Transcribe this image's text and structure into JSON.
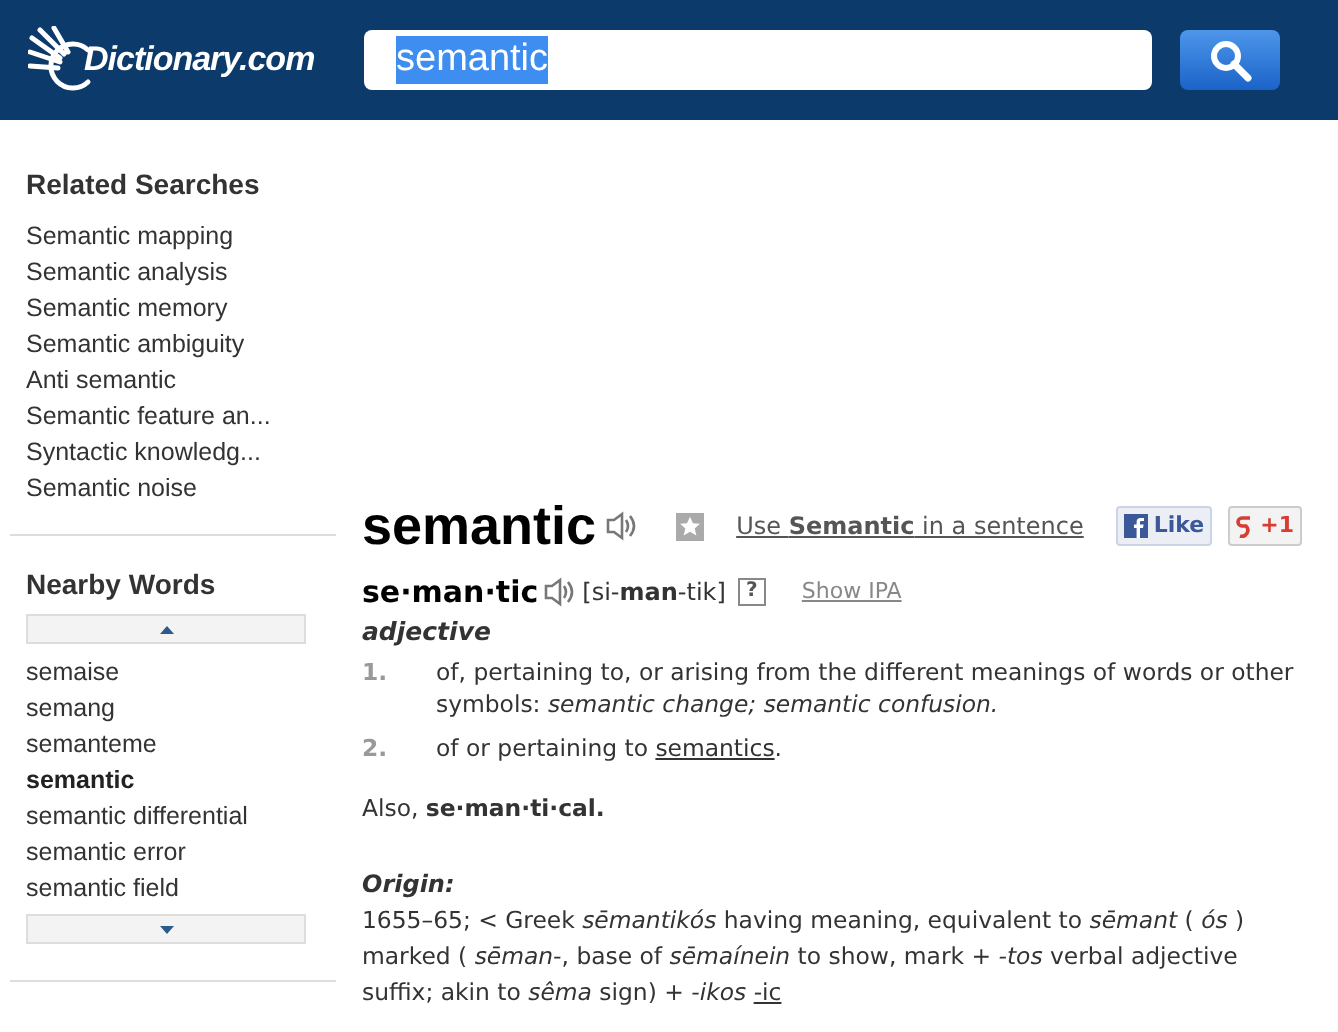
{
  "header": {
    "logo": "Dictionary.com",
    "search": {
      "value": "semantic",
      "selected": true
    }
  },
  "related_searches": {
    "title": "Related Searches",
    "items": [
      "Semantic mapping",
      "Semantic analysis",
      "Semantic memory",
      "Semantic ambiguity",
      "Anti semantic",
      "Semantic feature an...",
      "Syntactic knowledg...",
      "Semantic noise"
    ]
  },
  "nearby_words": {
    "title": "Nearby Words",
    "items": [
      {
        "label": "semaise",
        "selected": false
      },
      {
        "label": "semang",
        "selected": false
      },
      {
        "label": "semanteme",
        "selected": false
      },
      {
        "label": "semantic",
        "selected": true
      },
      {
        "label": "semantic differential",
        "selected": false
      },
      {
        "label": "semantic error",
        "selected": false
      },
      {
        "label": "semantic field",
        "selected": false
      }
    ]
  },
  "entry": {
    "headword": "semantic",
    "sentence_link": "Use **Semantic** in a sentence",
    "like": "Like",
    "plus_one": "+1",
    "syllables": "se·man·tic",
    "pronunciation": "[si-**man**-tik]",
    "help": "?",
    "show_ipa": "Show IPA",
    "part_of_speech": "adjective",
    "definitions": [
      {
        "number": "1.",
        "text": "of, pertaining to, or arising from the different meanings of words or other symbols: *semantic change; semantic confusion.*"
      },
      {
        "number": "2.",
        "text": "of or pertaining to ",
        "link": "semantics",
        "after": "."
      }
    ],
    "also": "Also, **se·man·ti·cal.**",
    "origin_label": "Origin:",
    "origin": "1655–65;  < Greek *sēmantikós*  having meaning, equivalent to *sēmant* ( *ós* ) marked ( *sēman-*,  base of *sēmaínein*  to show, mark + *-tos*  verbal adjective suffix; akin to *sêma*  sign) + *-ikos* ",
    "origin_link": "-ic"
  }
}
